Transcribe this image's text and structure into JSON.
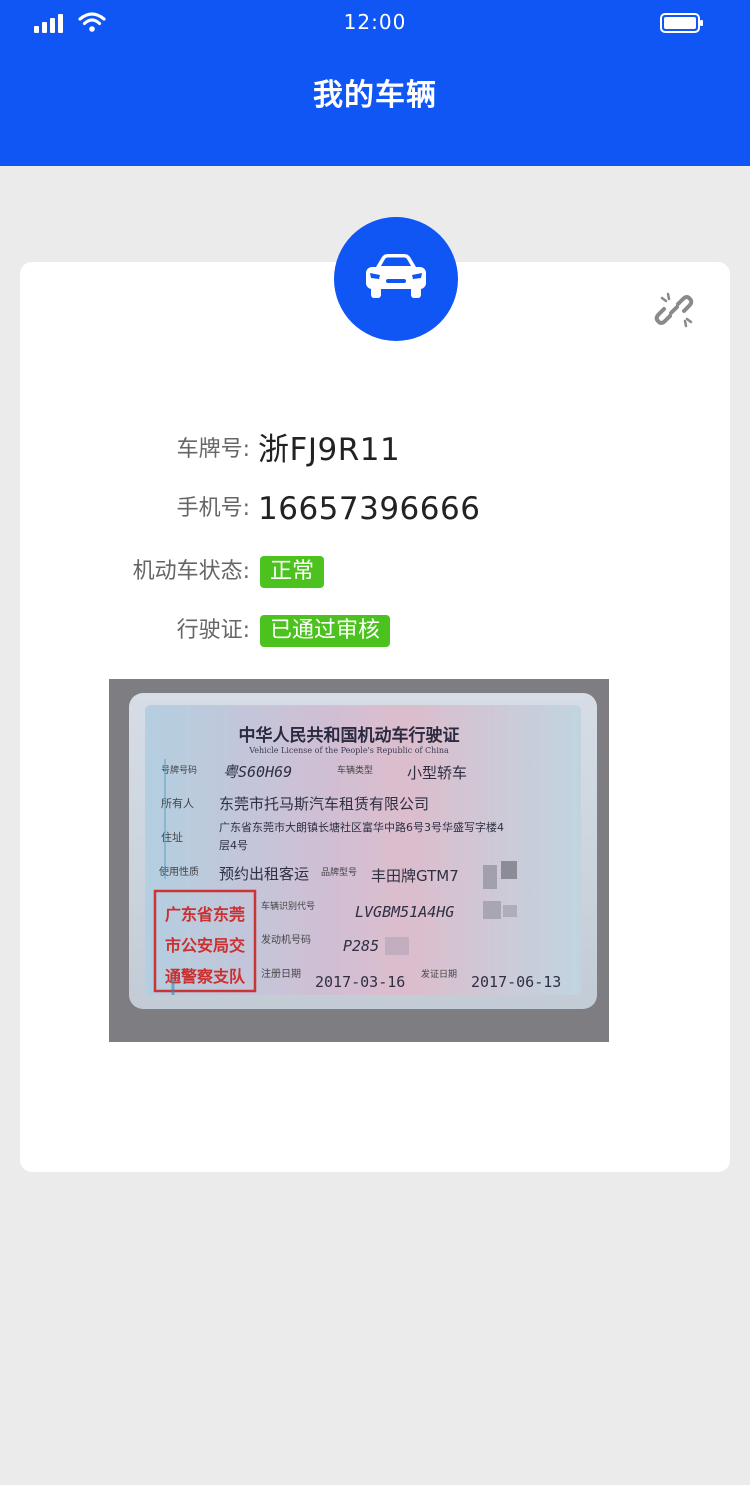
{
  "status_bar": {
    "time": "12:00"
  },
  "header": {
    "title": "我的车辆"
  },
  "vehicle": {
    "plate_label": "车牌号:",
    "plate_value": "浙FJ9R11",
    "phone_label": "手机号:",
    "phone_value": "16657396666",
    "status_label": "机动车状态:",
    "status_value": "正常",
    "license_label": "行驶证:",
    "license_value": "已通过审核"
  },
  "license_image": {
    "title_cn": "中华人民共和国机动车行驶证",
    "title_en": "Vehicle License of the People's Republic of China",
    "plate_no": "粤S60H69",
    "vehicle_type": "小型轿车",
    "owner": "东莞市托马斯汽车租赁有限公司",
    "address_line1": "广东省东莞市大朗镇长塘社区富华中路6号3号华盛写字楼4",
    "address_line2": "层4号",
    "use_character": "预约出租客运",
    "model": "丰田牌GTM7",
    "vin": "LVGBM51A4HG",
    "engine_no": "P285",
    "register_date": "2017-03-16",
    "issue_date": "2017-06-13",
    "stamp_line1": "广东省东莞",
    "stamp_line2": "市公安局交",
    "stamp_line3": "通警察支队",
    "field_plate": "号牌号码",
    "field_type": "车辆类型",
    "field_owner": "所有人",
    "field_address": "住址",
    "field_use": "使用性质",
    "field_model": "品牌型号",
    "field_vin": "车辆识别代号",
    "field_engine": "发动机号码",
    "field_register": "注册日期",
    "field_issue": "发证日期"
  },
  "colors": {
    "primary": "#0f56f5",
    "tag_green": "#4cc21f",
    "background": "#ebebeb"
  },
  "icons": [
    "signal-icon",
    "wifi-icon",
    "battery-icon",
    "car-icon",
    "unbind-link-icon"
  ]
}
